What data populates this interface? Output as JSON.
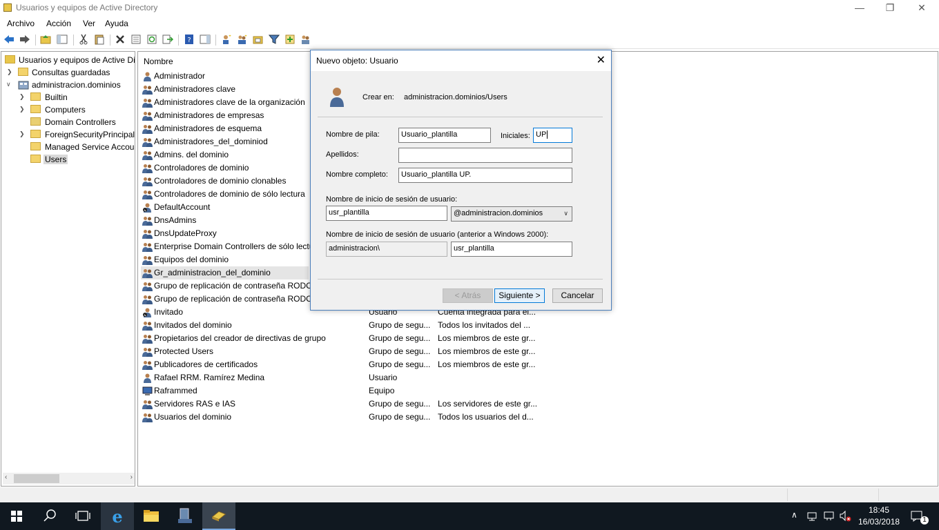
{
  "window": {
    "title": "Usuarios y equipos de Active Directory"
  },
  "window_controls": {
    "minimize": "—",
    "maximize": "❐",
    "close": "✕"
  },
  "menu": [
    "Archivo",
    "Acción",
    "Ver",
    "Ayuda"
  ],
  "tree": {
    "root": "Usuarios y equipos de Active Dir",
    "saved_queries": "Consultas guardadas",
    "domain": "administracion.dominios",
    "children": [
      "Builtin",
      "Computers",
      "Domain Controllers",
      "ForeignSecurityPrincipals",
      "Managed Service Accour",
      "Users"
    ]
  },
  "list": {
    "column_name": "Nombre",
    "rows": [
      {
        "name": "Administrador",
        "type": "",
        "desc": "",
        "icon": "user-icon"
      },
      {
        "name": "Administradores clave",
        "type": "",
        "desc": "",
        "icon": "group-icon"
      },
      {
        "name": "Administradores clave de la organización",
        "type": "",
        "desc": "",
        "icon": "group-icon"
      },
      {
        "name": "Administradores de empresas",
        "type": "",
        "desc": "",
        "icon": "group-icon"
      },
      {
        "name": "Administradores de esquema",
        "type": "",
        "desc": "",
        "icon": "group-icon"
      },
      {
        "name": "Administradores_del_dominiod",
        "type": "",
        "desc": "",
        "icon": "group-icon"
      },
      {
        "name": "Admins. del dominio",
        "type": "",
        "desc": "",
        "icon": "group-icon"
      },
      {
        "name": "Controladores de dominio",
        "type": "",
        "desc": "",
        "icon": "group-icon"
      },
      {
        "name": "Controladores de dominio clonables",
        "type": "",
        "desc": "",
        "icon": "group-icon"
      },
      {
        "name": "Controladores de dominio de sólo lectura",
        "type": "",
        "desc": "",
        "icon": "group-icon"
      },
      {
        "name": "DefaultAccount",
        "type": "",
        "desc": "",
        "icon": "user-disabled-icon"
      },
      {
        "name": "DnsAdmins",
        "type": "",
        "desc": "",
        "icon": "group-icon"
      },
      {
        "name": "DnsUpdateProxy",
        "type": "",
        "desc": "",
        "icon": "group-icon"
      },
      {
        "name": "Enterprise Domain Controllers de sólo lectu",
        "type": "",
        "desc": "",
        "icon": "group-icon"
      },
      {
        "name": "Equipos del dominio",
        "type": "",
        "desc": "",
        "icon": "group-icon"
      },
      {
        "name": "Gr_administracion_del_dominio",
        "type": "",
        "desc": "",
        "icon": "group-icon"
      },
      {
        "name": "Grupo de replicación de contraseña RODC",
        "type": "",
        "desc": "",
        "icon": "group-icon"
      },
      {
        "name": "Grupo de replicación de contraseña RODC",
        "type": "",
        "desc": "",
        "icon": "group-icon"
      },
      {
        "name": "Invitado",
        "type": "Usuario",
        "desc": "Cuenta integrada para el...",
        "icon": "user-disabled-icon"
      },
      {
        "name": "Invitados del dominio",
        "type": "Grupo de segu...",
        "desc": "Todos los invitados del ...",
        "icon": "group-icon"
      },
      {
        "name": "Propietarios del creador de directivas de grupo",
        "type": "Grupo de segu...",
        "desc": "Los miembros de este gr...",
        "icon": "group-icon"
      },
      {
        "name": "Protected Users",
        "type": "Grupo de segu...",
        "desc": "Los miembros de este gr...",
        "icon": "group-icon"
      },
      {
        "name": "Publicadores de certificados",
        "type": "Grupo de segu...",
        "desc": "Los miembros de este gr...",
        "icon": "group-icon"
      },
      {
        "name": "Rafael RRM. Ramírez Medina",
        "type": "Usuario",
        "desc": "",
        "icon": "user-icon"
      },
      {
        "name": "Raframmed",
        "type": "Equipo",
        "desc": "",
        "icon": "computer-icon"
      },
      {
        "name": "Servidores RAS e IAS",
        "type": "Grupo de segu...",
        "desc": "Los servidores de este gr...",
        "icon": "group-icon"
      },
      {
        "name": "Usuarios del dominio",
        "type": "Grupo de segu...",
        "desc": "Todos los usuarios del d...",
        "icon": "group-icon"
      }
    ]
  },
  "dialog": {
    "title": "Nuevo objeto: Usuario",
    "create_in_label": "Crear en:",
    "create_in_value": "administracion.dominios/Users",
    "first_name_label": "Nombre de pila:",
    "first_name": "Usuario_plantilla",
    "initials_label": "Iniciales:",
    "initials": "UP",
    "last_name_label": "Apellidos:",
    "last_name": "",
    "full_name_label": "Nombre completo:",
    "full_name": "Usuario_plantilla UP.",
    "logon_label": "Nombre de inicio de sesión de usuario:",
    "logon_name": "usr_plantilla",
    "logon_domain": "@administracion.dominios",
    "pre2000_label": "Nombre de inicio de sesión de usuario (anterior a Windows 2000):",
    "pre2000_domain": "administracion\\",
    "pre2000_name": "usr_plantilla",
    "back_button": "< Atrás",
    "next_button": "Siguiente >",
    "cancel_button": "Cancelar"
  },
  "taskbar": {
    "time": "18:45",
    "date": "16/03/2018",
    "notification_count": "1"
  }
}
